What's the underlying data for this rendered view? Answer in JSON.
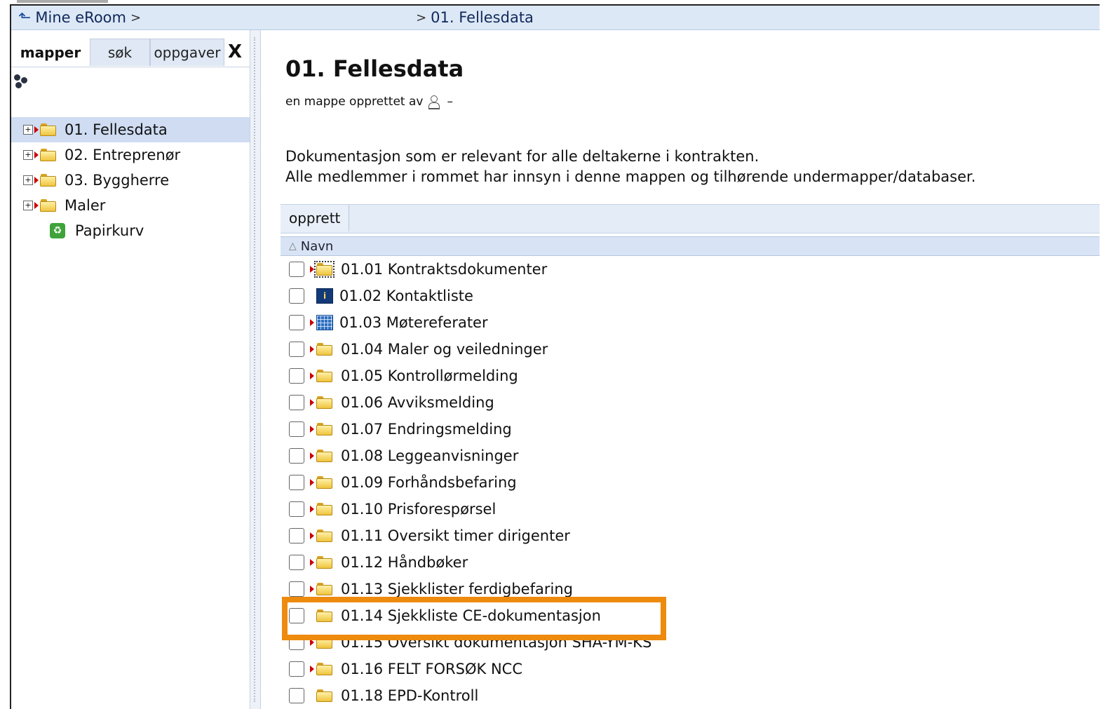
{
  "breadcrumb": {
    "root": "Mine eRoom",
    "sep1": ">",
    "sep2": ">",
    "current": "01. Fellesdata"
  },
  "sidebar": {
    "tabs": [
      {
        "label": "mapper",
        "active": true
      },
      {
        "label": "søk",
        "active": false
      },
      {
        "label": "oppgaver",
        "active": false
      }
    ],
    "close": "X",
    "tree": [
      {
        "label": "01. Fellesdata",
        "selected": true,
        "icon": "folder-icon"
      },
      {
        "label": "02. Entreprenør",
        "selected": false,
        "icon": "folder-icon"
      },
      {
        "label": "03. Byggherre",
        "selected": false,
        "icon": "folder-icon"
      },
      {
        "label": "Maler",
        "selected": false,
        "icon": "folder-icon"
      },
      {
        "label": "Papirkurv",
        "selected": false,
        "icon": "recycle-bin-icon"
      }
    ]
  },
  "main": {
    "title": "01. Fellesdata",
    "created_by": "en mappe opprettet av",
    "created_dash": "–",
    "description_line1": "Dokumentasjon som er relevant for alle deltakerne i kontrakten.",
    "description_line2": "Alle medlemmer i rommet har innsyn i denne mappen og tilhørende undermapper/databaser.",
    "create_button": "opprett",
    "column_name": "Navn",
    "sort_icon": "△"
  },
  "items": [
    {
      "name": "01.01 Kontraktsdokumenter",
      "icon": "folder-icon"
    },
    {
      "name": "01.02 Kontaktliste",
      "icon": "contact-list-icon"
    },
    {
      "name": "01.03 Møtereferater",
      "icon": "database-icon"
    },
    {
      "name": "01.04 Maler og veiledninger",
      "icon": "folder-icon"
    },
    {
      "name": "01.05 Kontrollørmelding",
      "icon": "folder-icon"
    },
    {
      "name": "01.06 Avviksmelding",
      "icon": "folder-icon"
    },
    {
      "name": "01.07 Endringsmelding",
      "icon": "folder-icon"
    },
    {
      "name": "01.08 Leggeanvisninger",
      "icon": "folder-icon"
    },
    {
      "name": "01.09 Forhåndsbefaring",
      "icon": "folder-icon"
    },
    {
      "name": "01.10 Prisforespørsel",
      "icon": "folder-icon"
    },
    {
      "name": "01.11 Oversikt timer dirigenter",
      "icon": "folder-icon"
    },
    {
      "name": "01.12 Håndbøker",
      "icon": "folder-icon"
    },
    {
      "name": "01.13 Sjekklister ferdigbefaring",
      "icon": "folder-icon"
    },
    {
      "name": "01.14 Sjekkliste CE-dokumentasjon",
      "icon": "folder-icon",
      "highlighted": true
    },
    {
      "name": "01.15 Oversikt dokumentasjon SHA-YM-KS",
      "icon": "folder-icon"
    },
    {
      "name": "01.16 FELT FORSØK NCC",
      "icon": "folder-icon"
    },
    {
      "name": "01.18 EPD-Kontroll",
      "icon": "folder-icon"
    }
  ],
  "highlight_color": "#ee8a0e"
}
